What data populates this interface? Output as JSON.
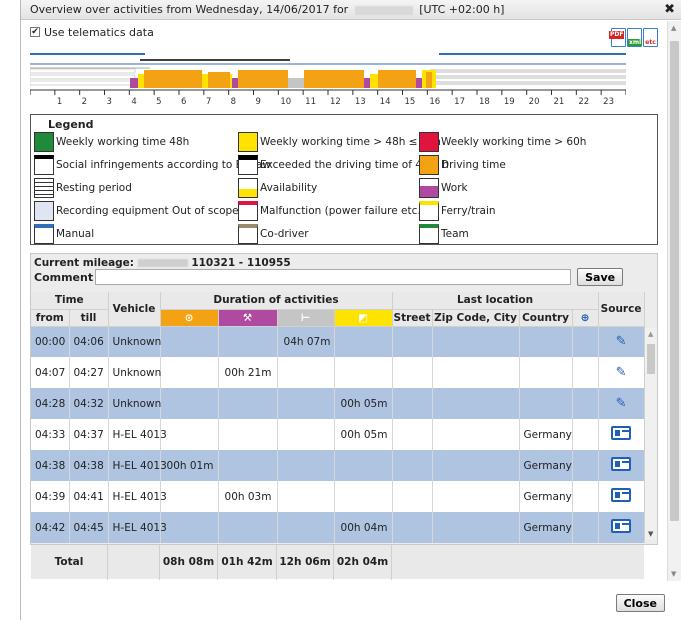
{
  "dialog": {
    "title_prefix": "Overview over activities from Wednesday, 14/06/2017 for",
    "title_suffix": "[UTC +02:00 h]",
    "close_glyph": "✖",
    "use_telematics_label": "Use telematics data",
    "use_telematics_checked": "✔",
    "close_button": "Close"
  },
  "export": {
    "pdf": "PDF",
    "xml": "xml",
    "etc": "etc"
  },
  "timeline": {
    "hours": [
      "1",
      "2",
      "3",
      "4",
      "5",
      "6",
      "7",
      "8",
      "9",
      "10",
      "11",
      "12",
      "13",
      "14",
      "15",
      "16",
      "17",
      "18",
      "19",
      "20",
      "21",
      "22",
      "23"
    ]
  },
  "legend": {
    "title": "Legend",
    "items": [
      {
        "label": "Weekly working time 48h",
        "color": "#1e8a3a"
      },
      {
        "label": "Weekly working time > 48h ≤ 60h",
        "color": "#ffe300"
      },
      {
        "label": "Weekly working time > 60h",
        "color": "#e0143c"
      },
      {
        "label": "Social infringements according to EC law",
        "color": "#000000"
      },
      {
        "label": "Exceeded the driving time of 4:30 h",
        "color": "#000000"
      },
      {
        "label": "Driving time",
        "color": "#f3a213"
      },
      {
        "label": "Resting period",
        "color": "#ffffff"
      },
      {
        "label": "Availability",
        "color": "#ffe300"
      },
      {
        "label": "Work",
        "color": "#b04aa1"
      },
      {
        "label": "Recording equipment Out of scope",
        "color": "#dfe6f1"
      },
      {
        "label": "Malfunction (power failure etc.)",
        "color": "#e0143c"
      },
      {
        "label": "Ferry/train",
        "color": "#ffe300"
      },
      {
        "label": "Manual",
        "color": "#2f6fb5"
      },
      {
        "label": "Co-driver",
        "color": "#9c8a6f"
      },
      {
        "label": "Team",
        "color": "#1e8a3a"
      }
    ]
  },
  "mileage": {
    "label": "Current mileage:",
    "range": "110321 - 110955"
  },
  "comment": {
    "label": "Comment",
    "value": "",
    "save_button": "Save"
  },
  "table": {
    "headers": {
      "time": "Time",
      "from": "from",
      "till": "till",
      "vehicle": "Vehicle",
      "duration": "Duration of activities",
      "last_location": "Last location",
      "street": "Street",
      "zip_city": "Zip Code, City",
      "country": "Country",
      "source": "Source"
    },
    "rows": [
      {
        "from": "00:00",
        "till": "04:06",
        "vehicle": "Unknown",
        "drive": "",
        "work": "",
        "rest": "04h 07m",
        "avail": "",
        "street": "",
        "zip": "",
        "country": "",
        "source": "manual-edit",
        "style": "blue"
      },
      {
        "from": "04:07",
        "till": "04:27",
        "vehicle": "Unknown",
        "drive": "",
        "work": "00h 21m",
        "rest": "",
        "avail": "",
        "street": "",
        "zip": "",
        "country": "",
        "source": "manual-edit",
        "style": "white"
      },
      {
        "from": "04:28",
        "till": "04:32",
        "vehicle": "Unknown",
        "drive": "",
        "work": "",
        "rest": "",
        "avail": "00h 05m",
        "street": "",
        "zip": "",
        "country": "",
        "source": "manual-edit",
        "style": "blue"
      },
      {
        "from": "04:33",
        "till": "04:37",
        "vehicle": "H-EL 4013",
        "drive": "",
        "work": "",
        "rest": "",
        "avail": "00h 05m",
        "street": "",
        "zip": "",
        "country": "Germany",
        "source": "card",
        "style": "white"
      },
      {
        "from": "04:38",
        "till": "04:38",
        "vehicle": "H-EL 4013",
        "drive": "00h 01m",
        "work": "",
        "rest": "",
        "avail": "",
        "street": "",
        "zip": "",
        "country": "Germany",
        "source": "card",
        "style": "blue"
      },
      {
        "from": "04:39",
        "till": "04:41",
        "vehicle": "H-EL 4013",
        "drive": "",
        "work": "00h 03m",
        "rest": "",
        "avail": "",
        "street": "",
        "zip": "",
        "country": "Germany",
        "source": "card",
        "style": "white"
      },
      {
        "from": "04:42",
        "till": "04:45",
        "vehicle": "H-EL 4013",
        "drive": "",
        "work": "",
        "rest": "",
        "avail": "00h 04m",
        "street": "",
        "zip": "",
        "country": "Germany",
        "source": "card",
        "style": "blue"
      }
    ],
    "totals": {
      "label": "Total",
      "drive": "08h 08m",
      "work": "01h 42m",
      "rest": "12h 06m",
      "avail": "02h 04m"
    }
  }
}
